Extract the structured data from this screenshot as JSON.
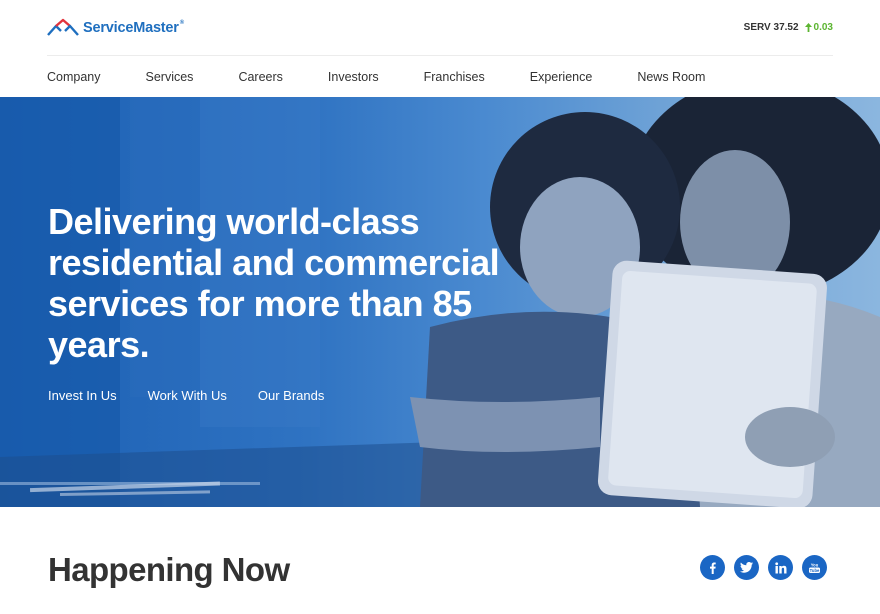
{
  "brand": {
    "name": "ServiceMaster",
    "trademark": "®"
  },
  "ticker": {
    "symbol": "SERV 37.52",
    "change": "0.03",
    "change_color": "#5cb531"
  },
  "nav": {
    "items": [
      {
        "label": "Company"
      },
      {
        "label": "Services"
      },
      {
        "label": "Careers"
      },
      {
        "label": "Investors"
      },
      {
        "label": "Franchises"
      },
      {
        "label": "Experience"
      },
      {
        "label": "News Room"
      }
    ]
  },
  "hero": {
    "title": "Delivering world-class residential and commercial services for more than 85 years.",
    "links": [
      {
        "label": "Invest In Us"
      },
      {
        "label": "Work With Us"
      },
      {
        "label": "Our Brands"
      }
    ]
  },
  "section": {
    "title": "Happening Now"
  },
  "social": {
    "icons": [
      "facebook-icon",
      "twitter-icon",
      "linkedin-icon",
      "youtube-icon"
    ],
    "color": "#1a66c4"
  },
  "colors": {
    "brand_blue": "#1f6fbf",
    "brand_red": "#e2343c"
  }
}
